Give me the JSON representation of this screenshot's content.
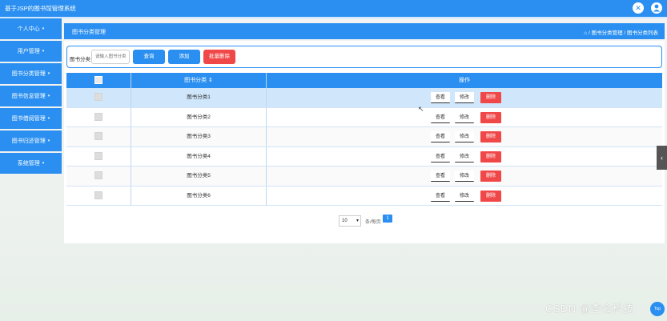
{
  "app": {
    "title": "基于JSP的图书馆管理系统",
    "close_icon": "close-icon",
    "user_icon": "user-icon"
  },
  "sidebar": {
    "items": [
      {
        "label": "个人中心",
        "caret": "▾"
      },
      {
        "label": "用户管理",
        "caret": "▾"
      },
      {
        "label": "图书分类管理",
        "caret": "▾"
      },
      {
        "label": "图书信息管理",
        "caret": "▾"
      },
      {
        "label": "图书借阅管理",
        "caret": "▾"
      },
      {
        "label": "图书归还管理",
        "caret": "▾"
      },
      {
        "label": "系统管理",
        "caret": "▾"
      }
    ]
  },
  "main": {
    "page_title": "图书分类管理",
    "breadcrumb": "⌂ / 图书分类管理 / 图书分类列表"
  },
  "search": {
    "label": "图书分类",
    "placeholder": "请输入图书分类",
    "search_button": "查询",
    "add_button": "添加",
    "batch_delete_button": "批量删除"
  },
  "table": {
    "headers": {
      "name": "图书分类 ⇕",
      "ops": "操作"
    },
    "rows": [
      {
        "name": "图书分类1"
      },
      {
        "name": "图书分类2"
      },
      {
        "name": "图书分类3"
      },
      {
        "name": "图书分类4"
      },
      {
        "name": "图书分类5"
      },
      {
        "name": "图书分类6"
      }
    ],
    "row_actions": {
      "view": "查看",
      "edit": "修改",
      "delete": "删除"
    }
  },
  "pagination": {
    "page_size": "10",
    "page_size_label": "条/每页",
    "current_page": "1"
  },
  "misc": {
    "edge_tab": "‹",
    "cursor": "↖",
    "watermark": "CSDN @李会科技",
    "top_button": "Top"
  },
  "colors": {
    "primary": "#2a8ff0",
    "danger": "#f04848"
  }
}
